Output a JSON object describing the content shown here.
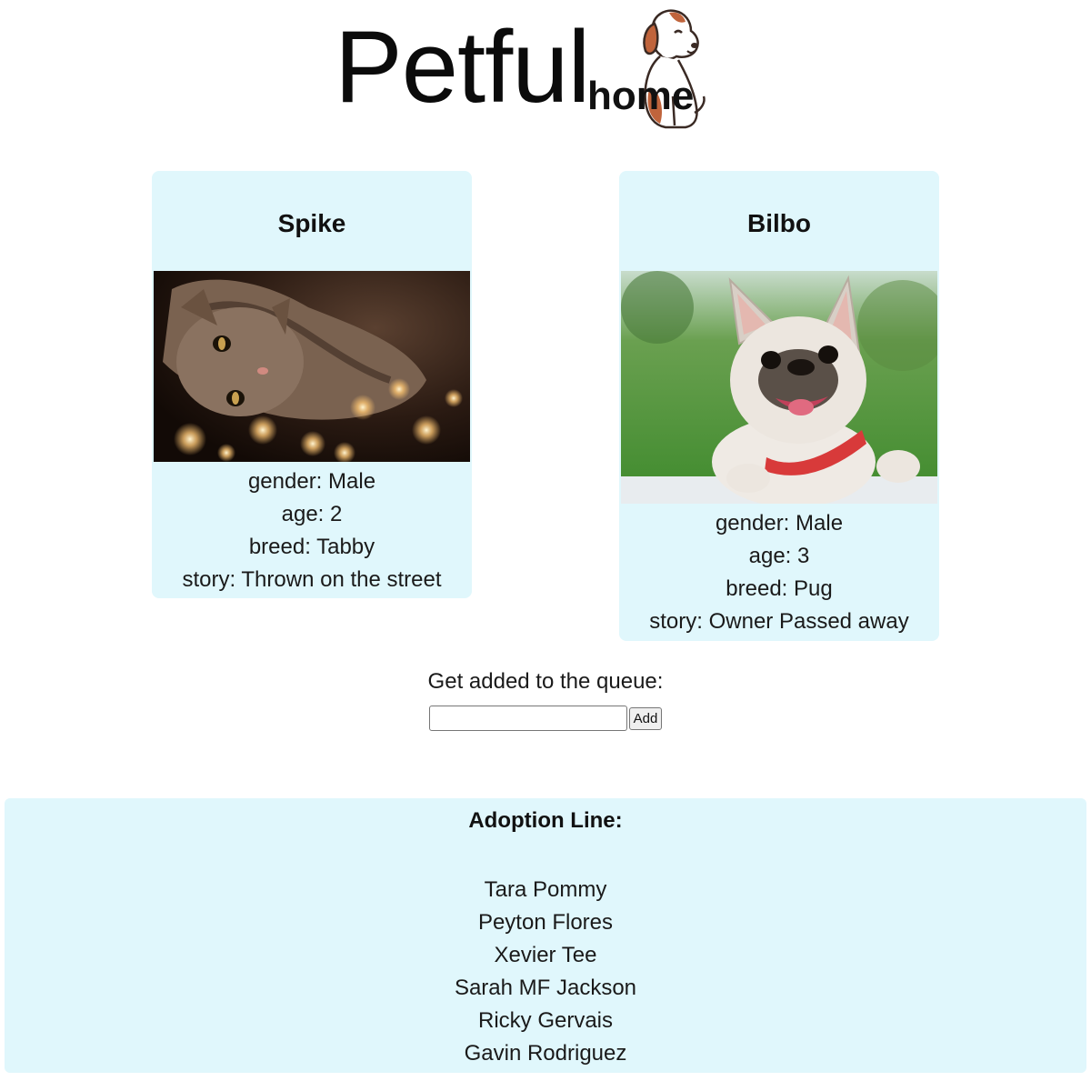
{
  "header": {
    "logo_main": "Petful",
    "logo_sub": "home"
  },
  "pets": {
    "cat": {
      "name": "Spike",
      "photo_icon": "cat-photo",
      "gender": "gender: Male",
      "age": "age: 2",
      "breed": "breed: Tabby",
      "story": "story: Thrown on the street"
    },
    "dog": {
      "name": "Bilbo",
      "photo_icon": "dog-photo",
      "gender": "gender: Male",
      "age": "age: 3",
      "breed": "breed: Pug",
      "story": "story: Owner Passed away"
    }
  },
  "queue": {
    "label": "Get added to the queue:",
    "input_value": "",
    "add_label": "Add"
  },
  "adoption": {
    "title": "Adoption Line:",
    "people": [
      "Tara Pommy",
      "Peyton Flores",
      "Xevier Tee",
      "Sarah MF Jackson",
      "Ricky Gervais",
      "Gavin Rodriguez"
    ]
  },
  "colors": {
    "card_bg": "#e0f7fc",
    "logo_dog_brown": "#c0643c",
    "page_bg": "#ffffff"
  }
}
